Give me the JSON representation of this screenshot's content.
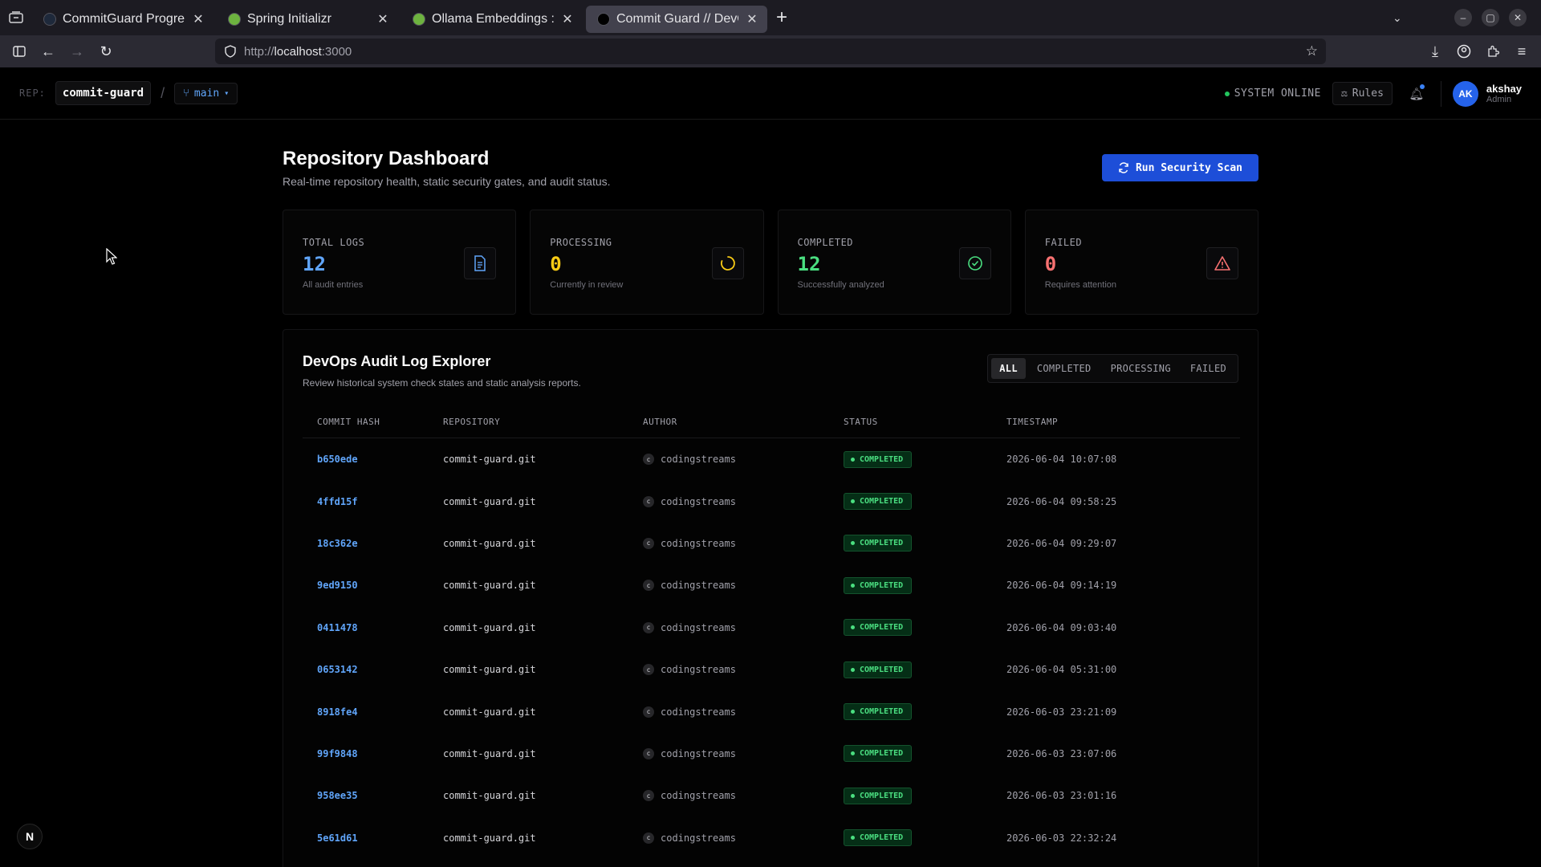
{
  "browser": {
    "tabs": [
      {
        "title": "CommitGuard Progress Track",
        "favicon": "#1e293b",
        "active": false
      },
      {
        "title": "Spring Initializr",
        "favicon": "#6db33f",
        "active": false
      },
      {
        "title": "Ollama Embeddings :: Spr",
        "favicon": "#6db33f",
        "active": false
      },
      {
        "title": "Commit Guard // DevOps",
        "favicon": "#000000",
        "active": true
      }
    ],
    "url_prefix": "http://",
    "url_host": "localhost",
    "url_port": ":3000"
  },
  "topnav": {
    "rep_label": "REP:",
    "repo_name": "commit-guard",
    "separator": "/",
    "branch": "main",
    "system_status": "SYSTEM ONLINE",
    "rules_label": "Rules",
    "user": {
      "initials": "AK",
      "name": "akshay",
      "role": "Admin"
    }
  },
  "header": {
    "title": "Repository Dashboard",
    "subtitle": "Real-time repository health, static security gates, and audit status.",
    "scan_button": "Run Security Scan"
  },
  "stats": [
    {
      "label": "TOTAL LOGS",
      "value": "12",
      "desc": "All audit entries",
      "color": "#60a5fa",
      "icon": "document-icon"
    },
    {
      "label": "PROCESSING",
      "value": "0",
      "desc": "Currently in review",
      "color": "#facc15",
      "icon": "spinner-icon"
    },
    {
      "label": "COMPLETED",
      "value": "12",
      "desc": "Successfully analyzed",
      "color": "#4ade80",
      "icon": "check-circle-icon"
    },
    {
      "label": "FAILED",
      "value": "0",
      "desc": "Requires attention",
      "color": "#f87171",
      "icon": "warning-icon"
    }
  ],
  "explorer": {
    "title": "DevOps Audit Log Explorer",
    "subtitle": "Review historical system check states and static analysis reports.",
    "filters": [
      "ALL",
      "COMPLETED",
      "PROCESSING",
      "FAILED"
    ],
    "active_filter": "ALL",
    "columns": [
      "COMMIT HASH",
      "REPOSITORY",
      "AUTHOR",
      "STATUS",
      "TIMESTAMP"
    ],
    "rows": [
      {
        "hash": "b650ede",
        "repo": "commit-guard.git",
        "author_initial": "c",
        "author": "codingstreams",
        "status": "COMPLETED",
        "ts": "2026-06-04 10:07:08"
      },
      {
        "hash": "4ffd15f",
        "repo": "commit-guard.git",
        "author_initial": "c",
        "author": "codingstreams",
        "status": "COMPLETED",
        "ts": "2026-06-04 09:58:25"
      },
      {
        "hash": "18c362e",
        "repo": "commit-guard.git",
        "author_initial": "c",
        "author": "codingstreams",
        "status": "COMPLETED",
        "ts": "2026-06-04 09:29:07"
      },
      {
        "hash": "9ed9150",
        "repo": "commit-guard.git",
        "author_initial": "c",
        "author": "codingstreams",
        "status": "COMPLETED",
        "ts": "2026-06-04 09:14:19"
      },
      {
        "hash": "0411478",
        "repo": "commit-guard.git",
        "author_initial": "c",
        "author": "codingstreams",
        "status": "COMPLETED",
        "ts": "2026-06-04 09:03:40"
      },
      {
        "hash": "0653142",
        "repo": "commit-guard.git",
        "author_initial": "c",
        "author": "codingstreams",
        "status": "COMPLETED",
        "ts": "2026-06-04 05:31:00"
      },
      {
        "hash": "8918fe4",
        "repo": "commit-guard.git",
        "author_initial": "c",
        "author": "codingstreams",
        "status": "COMPLETED",
        "ts": "2026-06-03 23:21:09"
      },
      {
        "hash": "99f9848",
        "repo": "commit-guard.git",
        "author_initial": "c",
        "author": "codingstreams",
        "status": "COMPLETED",
        "ts": "2026-06-03 23:07:06"
      },
      {
        "hash": "958ee35",
        "repo": "commit-guard.git",
        "author_initial": "c",
        "author": "codingstreams",
        "status": "COMPLETED",
        "ts": "2026-06-03 23:01:16"
      },
      {
        "hash": "5e61d61",
        "repo": "commit-guard.git",
        "author_initial": "c",
        "author": "codingstreams",
        "status": "COMPLETED",
        "ts": "2026-06-03 22:32:24"
      }
    ]
  },
  "dev_badge": "N"
}
